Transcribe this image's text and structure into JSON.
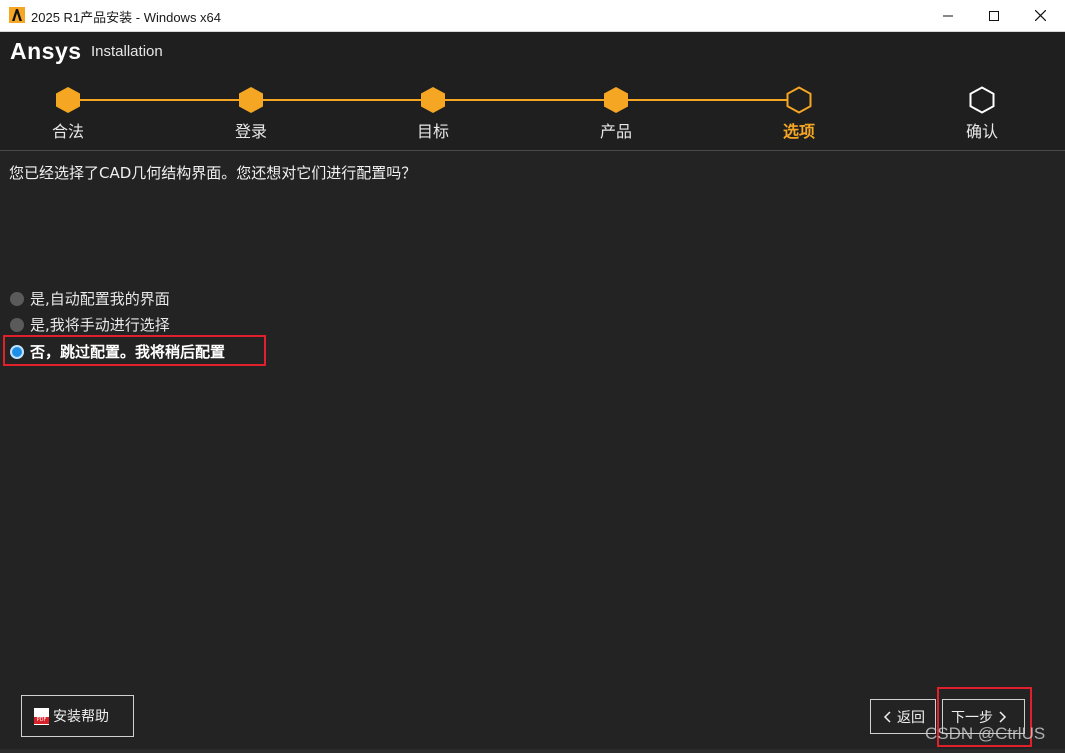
{
  "window": {
    "title": "2025 R1产品安装 - Windows x64"
  },
  "brand": {
    "name": "Ansys",
    "subtitle": "Installation"
  },
  "steps": [
    {
      "label": "合法",
      "state": "done"
    },
    {
      "label": "登录",
      "state": "done"
    },
    {
      "label": "目标",
      "state": "done"
    },
    {
      "label": "产品",
      "state": "done"
    },
    {
      "label": "选项",
      "state": "active"
    },
    {
      "label": "确认",
      "state": "pending"
    }
  ],
  "question": "您已经选择了CAD几何结构界面。您还想对它们进行配置吗？",
  "options": [
    {
      "label": "是,自动配置我的界面",
      "selected": false
    },
    {
      "label": "是,我将手动进行选择",
      "selected": false
    },
    {
      "label": "否，跳过配置。我将稍后配置",
      "selected": true
    }
  ],
  "buttons": {
    "help": "安装帮助",
    "back": "返回",
    "next": "下一步"
  },
  "watermark": "CSDN @CtrlUS",
  "colors": {
    "accent": "#f5a623",
    "radio_selected": "#1e8fe8",
    "highlight": "#e0202a"
  }
}
